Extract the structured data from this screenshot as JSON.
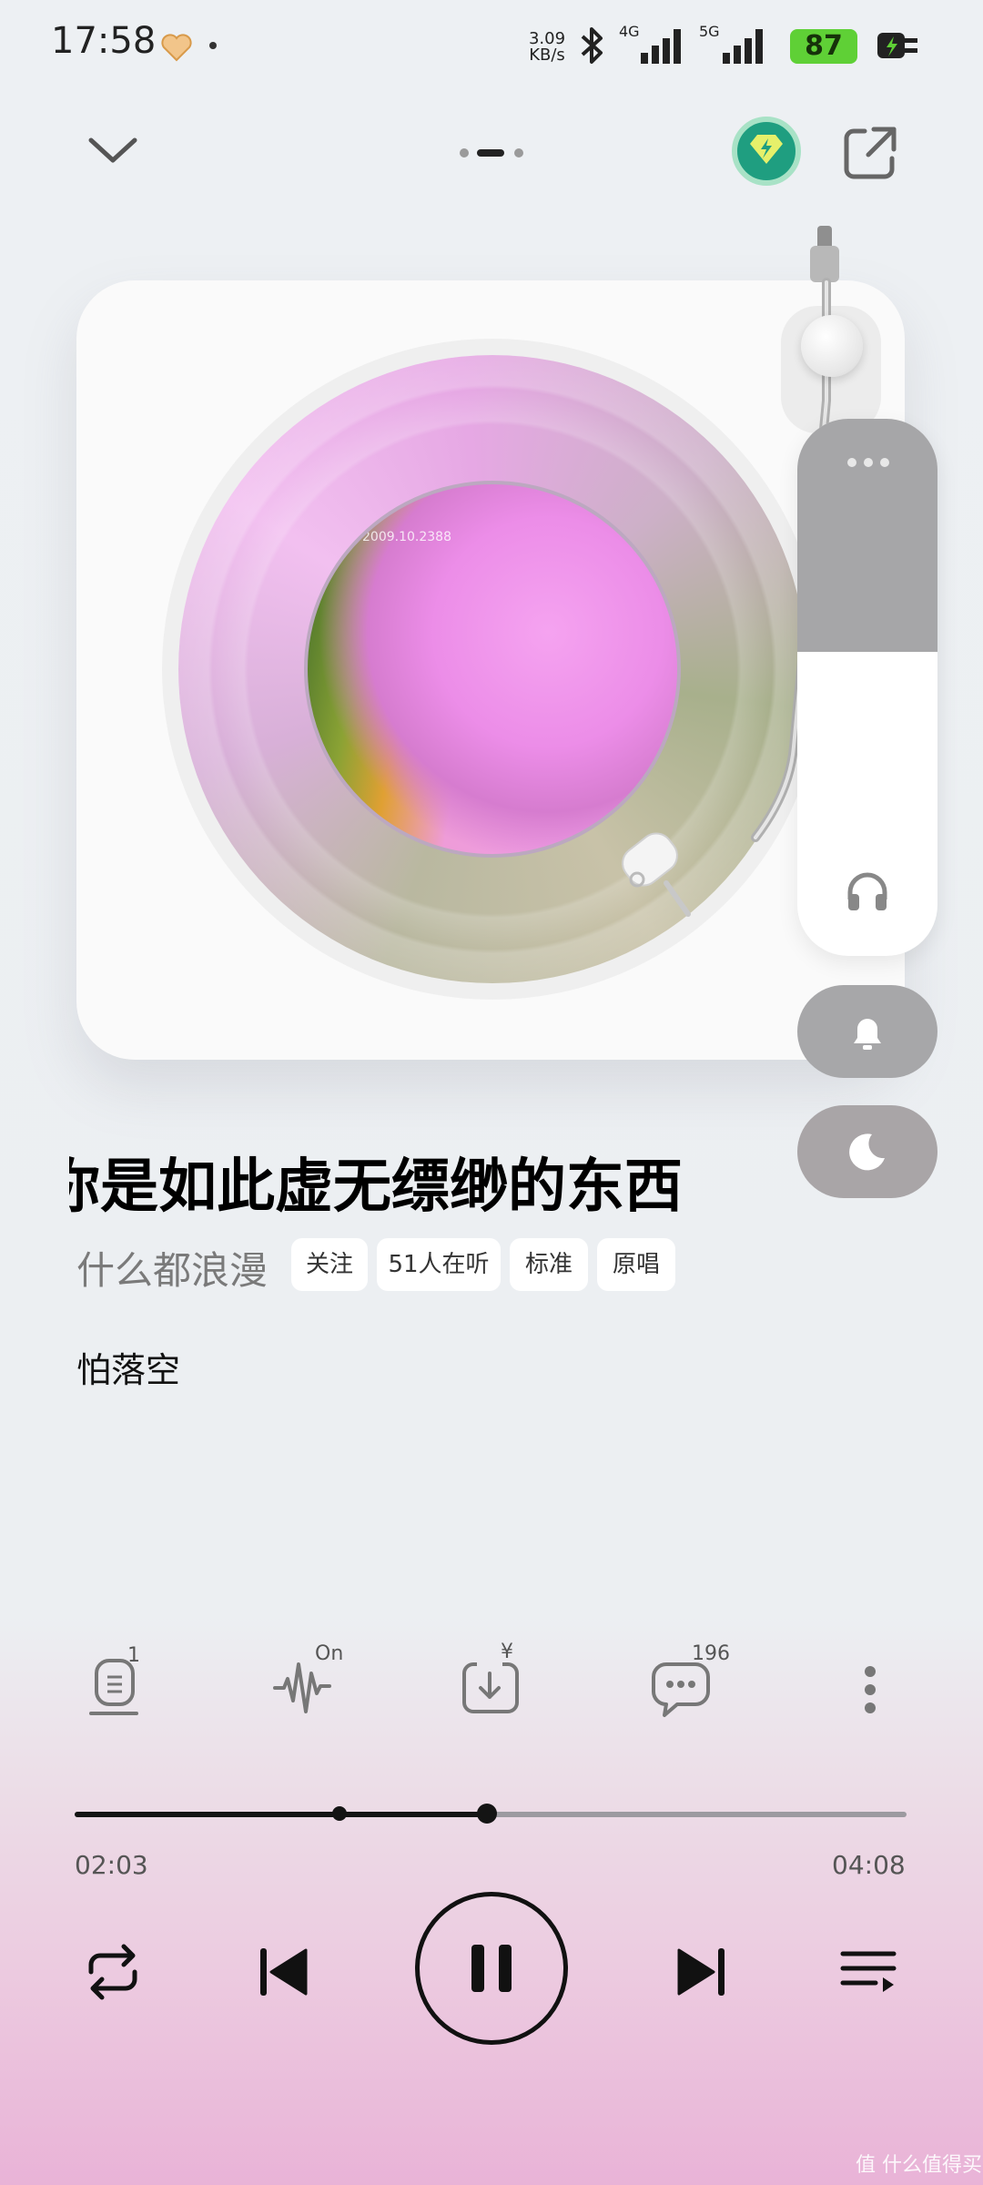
{
  "status_bar": {
    "time": "17:58",
    "net_speed_value": "3.09",
    "net_speed_unit": "KB/s",
    "network_1": "4G",
    "network_2": "5G",
    "battery": "87",
    "battery_color": "#5fd036"
  },
  "header": {
    "collapse_icon": "chevron-down-icon",
    "page_indicator_active": 2,
    "page_indicator_count": 3,
    "vip_icon": "diamond-lightning-icon",
    "share_icon": "share-icon"
  },
  "player": {
    "album_art_caption": "2009.10.2388",
    "side_panel": {
      "more_icon": "more-dots-icon",
      "headphone_icon": "headphone-icon",
      "bell_icon": "bell-icon",
      "moon_icon": "moon-icon"
    }
  },
  "song": {
    "title": "你是如此虚无缥缈的东西",
    "artist": "什么都浪漫",
    "chips": {
      "follow": "关注",
      "listeners": "51人在听",
      "quality": "标准",
      "original": "原唱"
    },
    "lyric": "怕落空"
  },
  "actions": {
    "lyrics_badge": "1",
    "effect_badge": "On",
    "download_badge": "¥",
    "comment_count": "196"
  },
  "progress": {
    "current": "02:03",
    "total": "04:08",
    "fraction": 0.496,
    "marker_fraction": 0.318
  },
  "controls": {
    "repeat_icon": "repeat-icon",
    "prev_icon": "previous-icon",
    "pause_icon": "pause-icon",
    "next_icon": "next-icon",
    "playlist_icon": "playlist-icon"
  },
  "watermark": "值 什么值得买"
}
